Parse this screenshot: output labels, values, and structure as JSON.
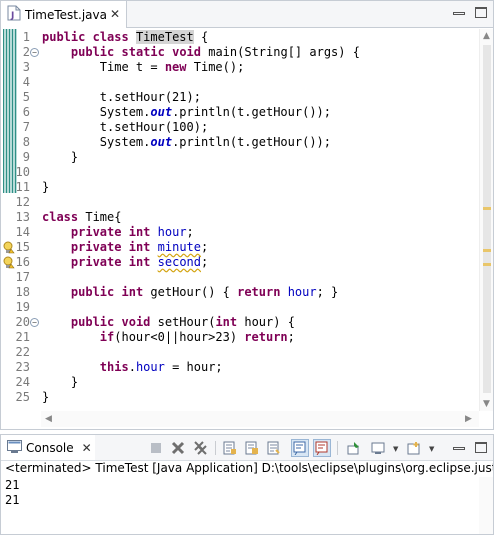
{
  "editor": {
    "tab_label": "TimeTest.java",
    "tab_icon": "java-file-icon",
    "close_glyph": "✕",
    "lines": [
      {
        "num": "1",
        "html": "<span class=\"kw\">public</span> <span class=\"kw\">class</span> <span class=\"hl\">TimeTest</span> {"
      },
      {
        "num": "2",
        "html": "    <span class=\"kw\">public</span> <span class=\"kw\">static</span> <span class=\"kw\">void</span> main(String[] args) {",
        "fold": true
      },
      {
        "num": "3",
        "html": "        Time t = <span class=\"kw\">new</span> Time();"
      },
      {
        "num": "4",
        "html": ""
      },
      {
        "num": "5",
        "html": "        t.setHour(21);"
      },
      {
        "num": "6",
        "html": "        System.<span class=\"sfld\">out</span>.println(t.getHour());"
      },
      {
        "num": "7",
        "html": "        t.setHour(100);"
      },
      {
        "num": "8",
        "html": "        System.<span class=\"sfld\">out</span>.println(t.getHour());"
      },
      {
        "num": "9",
        "html": "    }"
      },
      {
        "num": "10",
        "html": ""
      },
      {
        "num": "11",
        "html": "}"
      },
      {
        "num": "12",
        "html": ""
      },
      {
        "num": "13",
        "html": "<span class=\"kw\">class</span> Time{"
      },
      {
        "num": "14",
        "html": "    <span class=\"kw\">private</span> <span class=\"kw\">int</span> <span class=\"fld\">hour</span>;"
      },
      {
        "num": "15",
        "html": "    <span class=\"kw\">private</span> <span class=\"kw\">int</span> <span class=\"fld squig\">minute</span>;",
        "warn": true
      },
      {
        "num": "16",
        "html": "    <span class=\"kw\">private</span> <span class=\"kw\">int</span> <span class=\"fld squig\">second</span>;",
        "warn": true
      },
      {
        "num": "17",
        "html": ""
      },
      {
        "num": "18",
        "html": "    <span class=\"kw\">public</span> <span class=\"kw\">int</span> getHour() { <span class=\"kw\">return</span> <span class=\"fld\">hour</span>; }"
      },
      {
        "num": "19",
        "html": ""
      },
      {
        "num": "20",
        "html": "    <span class=\"kw\">public</span> <span class=\"kw\">void</span> setHour(<span class=\"kw\">int</span> hour) {",
        "fold": true
      },
      {
        "num": "21",
        "html": "        <span class=\"kw\">if</span>(hour&lt;0||hour&gt;23) <span class=\"kw\">return</span>;"
      },
      {
        "num": "22",
        "html": ""
      },
      {
        "num": "23",
        "html": "        <span class=\"kw\">this</span>.<span class=\"fld\">hour</span> = hour;"
      },
      {
        "num": "24",
        "html": "    }"
      },
      {
        "num": "25",
        "html": "}"
      }
    ]
  },
  "console": {
    "tab_label": "Console",
    "close_glyph": "✕",
    "status": "<terminated> TimeTest [Java Application] D:\\tools\\eclipse\\plugins\\org.eclipse.justj.open",
    "output": [
      "21",
      "21"
    ]
  },
  "colors": {
    "keyword": "#7f0055",
    "field": "#0000c0",
    "change_ruler": "#6fb7b0",
    "warning": "#e9c66a"
  }
}
